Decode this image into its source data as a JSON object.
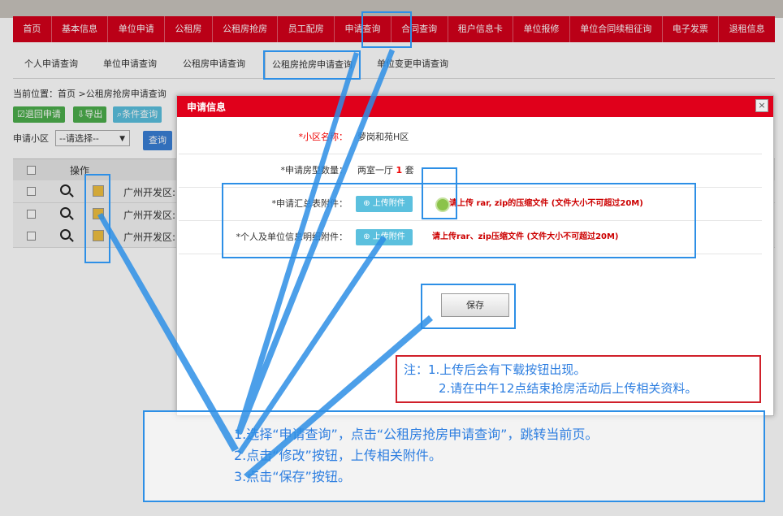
{
  "nav": [
    "首页",
    "基本信息",
    "单位申请",
    "公租房",
    "公租房抢房",
    "员工配房",
    "申请查询",
    "合同查询",
    "租户信息卡",
    "单位报修",
    "单位合同续租征询",
    "电子发票",
    "退租信息"
  ],
  "subtabs": [
    "个人申请查询",
    "单位申请查询",
    "公租房申请查询",
    "公租房抢房申请查询",
    "单位变更申请查询"
  ],
  "breadcrumb": "当前位置：首页 >公租房抢房申请查询",
  "toolbar": {
    "back": "退回申请",
    "export": "导出",
    "search": "条件查询"
  },
  "filter": {
    "label": "申请小区",
    "select": "--请选择--",
    "query": "查询"
  },
  "table": {
    "op_header": "操作",
    "rows": [
      "广州开发区:",
      "广州开发区:",
      "广州开发区:"
    ]
  },
  "modal": {
    "title": "申请信息",
    "close": "×",
    "community_label": "*小区名称：",
    "community_value": "萝岗和苑H区",
    "rooms_label": "*申请房型数量：",
    "rooms_type": "两室一厅",
    "rooms_count": "1",
    "rooms_unit": "套",
    "summary_label": "*申请汇总表附件：",
    "summary_hint": "请上传 rar, zip的压缩文件 (文件大小不可超过20M)",
    "detail_label": "*个人及单位信息明细附件：",
    "detail_hint": "请上传rar、zip压缩文件 (文件大小不可超过20M)",
    "upload": "上传附件",
    "save": "保存"
  },
  "note": {
    "line1": "注：1.上传后会有下载按钮出现。",
    "line2": "2.请在中午12点结束抢房活动后上传相关资料。"
  },
  "instructions": [
    "1.选择“申请查询”，点击“公租房抢房申请查询”，跳转当前页。",
    "2.点击“修改”按钮，上传相关附件。",
    "3.点击“保存”按钮。"
  ],
  "colors": {
    "nav_red": "#d4001b",
    "annotation_blue": "#2d8fe6",
    "note_border": "#d0202a"
  }
}
